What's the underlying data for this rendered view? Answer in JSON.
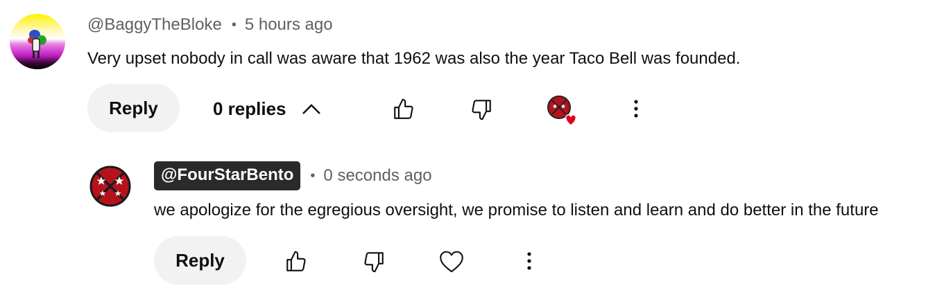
{
  "comment": {
    "handle": "@BaggyTheBloke",
    "separator": "•",
    "time": "5 hours ago",
    "text": "Very upset nobody in call was aware that 1962 was also the year Taco Bell was founded.",
    "reply_label": "Reply",
    "replies_label": "0 replies",
    "icons": {
      "toggle": "chevron-up-icon",
      "like": "thumbs-up-icon",
      "dislike": "thumbs-down-icon",
      "creator_heart": "creator-heart-badge-icon",
      "more": "more-vertical-icon"
    }
  },
  "reply": {
    "handle": "@FourStarBento",
    "separator": "•",
    "time": "0 seconds ago",
    "text": "we apologize for the egregious oversight, we promise to listen and learn and do better in the future",
    "reply_label": "Reply",
    "icons": {
      "like": "thumbs-up-icon",
      "dislike": "thumbs-down-icon",
      "heart": "heart-outline-icon",
      "more": "more-vertical-icon"
    }
  },
  "colors": {
    "text": "#0f0f0f",
    "secondary_text": "#606060",
    "button_bg": "#f2f2f2",
    "handle_badge_bg": "#2a2a2a",
    "heart_red": "#e0001a",
    "channel_red": "#b5121b"
  }
}
